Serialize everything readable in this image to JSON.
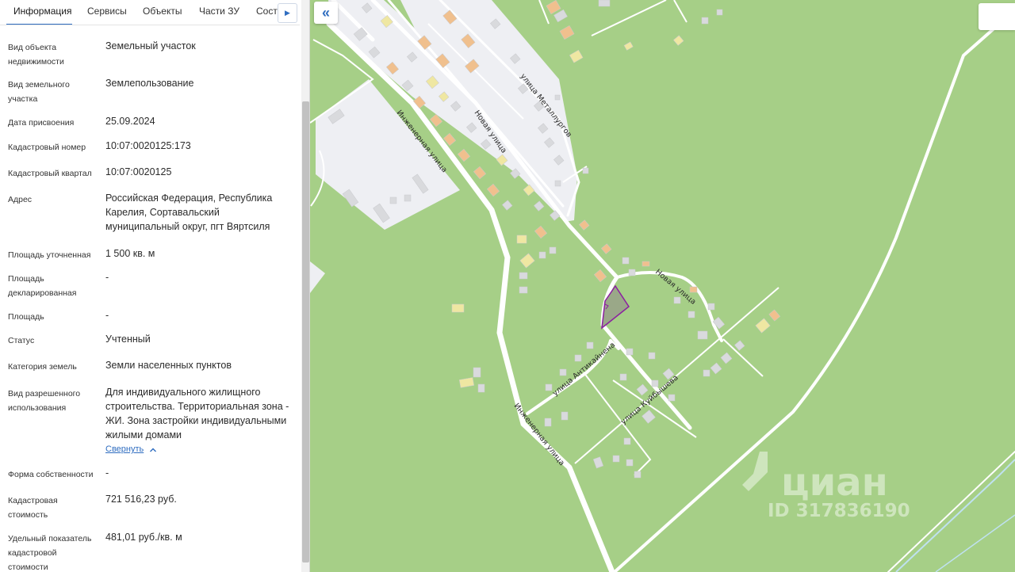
{
  "tabs": [
    {
      "label": "Информация",
      "active": true
    },
    {
      "label": "Сервисы",
      "active": false
    },
    {
      "label": "Объекты",
      "active": false
    },
    {
      "label": "Части ЗУ",
      "active": false
    },
    {
      "label": "Состав",
      "active": false
    }
  ],
  "info": {
    "object_type": {
      "label": "Вид объекта недвижимости",
      "value": "Земельный участок"
    },
    "land_kind": {
      "label": "Вид земельного участка",
      "value": "Землепользование"
    },
    "assign_date": {
      "label": "Дата присвоения",
      "value": "25.09.2024"
    },
    "cadastral_number": {
      "label": "Кадастровый номер",
      "value": "10:07:0020125:173"
    },
    "cadastral_block": {
      "label": "Кадастровый квартал",
      "value": "10:07:0020125"
    },
    "address": {
      "label": "Адрес",
      "value": "Российская Федерация, Республика Карелия, Сортавальский муниципальный округ, пгт Вяртсиля"
    },
    "area_refined": {
      "label": "Площадь уточненная",
      "value": "1 500 кв. м"
    },
    "area_declared": {
      "label": "Площадь декларированная",
      "value": "-"
    },
    "area": {
      "label": "Площадь",
      "value": "-"
    },
    "status": {
      "label": "Статус",
      "value": "Учтенный"
    },
    "land_category": {
      "label": "Категория земель",
      "value": "Земли населенных пунктов"
    },
    "permitted_use": {
      "label": "Вид разрешенного использования",
      "value": "Для индивидуального жилищного строительства. Территориальная зона - ЖИ. Зона застройки индивидуальными жилыми домами",
      "collapse_label": "Свернуть"
    },
    "ownership_form": {
      "label": "Форма собственности",
      "value": "-"
    },
    "cadastral_value": {
      "label": "Кадастровая стоимость",
      "value": "721 516,23 руб."
    },
    "specific_value": {
      "label": "Удельный показатель кадастровой стоимости",
      "value": "481,01 руб./кв. м"
    }
  },
  "map": {
    "streets": {
      "inzhenernaya_1": "Инженерная улица",
      "inzhenernaya_2": "Инженерная улица",
      "novaya_1": "Новая улица",
      "novaya_2": "Новая улица",
      "metallurgov": "улица Металлургов",
      "antikajnena": "улица Антикайнена",
      "kujbysheva": "улица Куйбышева"
    },
    "watermark": {
      "brand": "циан",
      "id": "ID 317836190"
    },
    "colors": {
      "vegetation": "#a6cf87",
      "built_area": "#eeeff3",
      "road": "#ffffff",
      "building_gray": "#d9dadd",
      "building_orange": "#f0c08e",
      "building_yellow": "#efe7a2",
      "parcel_fill": "#9aa888",
      "parcel_stroke": "#8b1fa0",
      "accent": "#2f6dc0"
    }
  }
}
